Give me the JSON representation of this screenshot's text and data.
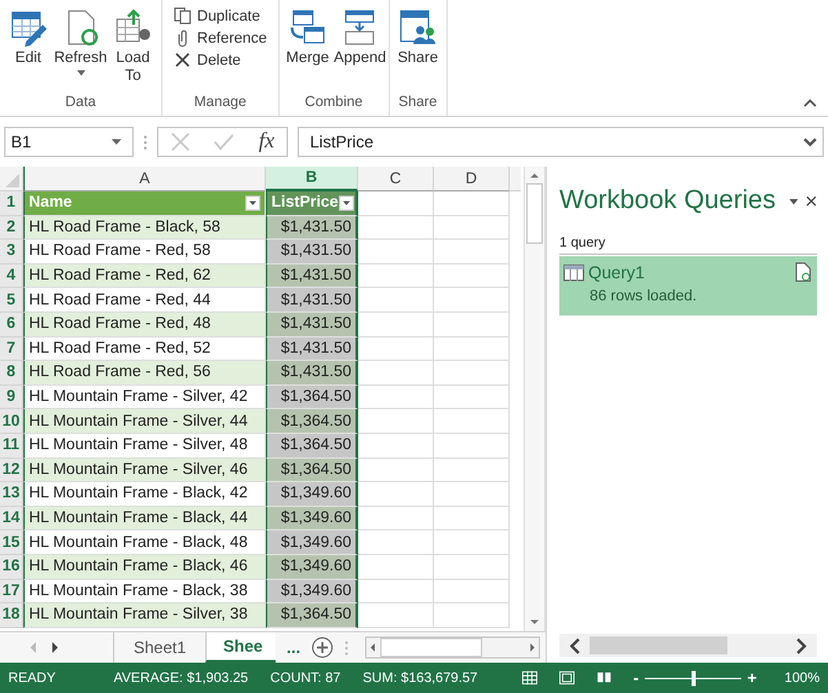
{
  "ribbon": {
    "groups": [
      {
        "label": "Data",
        "buttons": [
          {
            "label": "Edit",
            "kind": "large",
            "has_menu": false
          },
          {
            "label": "Refresh",
            "kind": "large",
            "has_menu": true
          },
          {
            "label": "Load To",
            "kind": "large",
            "has_menu": false
          }
        ]
      },
      {
        "label": "Manage",
        "buttons": [
          {
            "label": "Duplicate",
            "kind": "small",
            "has_menu": false
          },
          {
            "label": "Reference",
            "kind": "small",
            "has_menu": false
          },
          {
            "label": "Delete",
            "kind": "small",
            "has_menu": false
          }
        ]
      },
      {
        "label": "Combine",
        "buttons": [
          {
            "label": "Merge",
            "kind": "large",
            "has_menu": false
          },
          {
            "label": "Append",
            "kind": "large",
            "has_menu": false
          }
        ]
      },
      {
        "label": "Share",
        "buttons": [
          {
            "label": "Share",
            "kind": "large",
            "has_menu": false
          }
        ]
      }
    ]
  },
  "formula_bar": {
    "name_box": "B1",
    "fx": "fx",
    "formula": "ListPrice"
  },
  "columns": [
    {
      "label": "A",
      "selected": false
    },
    {
      "label": "B",
      "selected": true
    },
    {
      "label": "C",
      "selected": false
    },
    {
      "label": "D",
      "selected": false
    }
  ],
  "table": {
    "rows": [
      {
        "number": "1",
        "name": "Name",
        "price": "ListPrice",
        "kind": "header"
      },
      {
        "number": "2",
        "name": "HL Road Frame - Black, 58",
        "price": "$1,431.50",
        "kind": "data"
      },
      {
        "number": "3",
        "name": "HL Road Frame - Red, 58",
        "price": "$1,431.50",
        "kind": "data"
      },
      {
        "number": "4",
        "name": "HL Road Frame - Red, 62",
        "price": "$1,431.50",
        "kind": "data"
      },
      {
        "number": "5",
        "name": "HL Road Frame - Red, 44",
        "price": "$1,431.50",
        "kind": "data"
      },
      {
        "number": "6",
        "name": "HL Road Frame - Red, 48",
        "price": "$1,431.50",
        "kind": "data"
      },
      {
        "number": "7",
        "name": "HL Road Frame - Red, 52",
        "price": "$1,431.50",
        "kind": "data"
      },
      {
        "number": "8",
        "name": "HL Road Frame - Red, 56",
        "price": "$1,431.50",
        "kind": "data"
      },
      {
        "number": "9",
        "name": "HL Mountain Frame - Silver, 42",
        "price": "$1,364.50",
        "kind": "data"
      },
      {
        "number": "10",
        "name": "HL Mountain Frame - Silver, 44",
        "price": "$1,364.50",
        "kind": "data"
      },
      {
        "number": "11",
        "name": "HL Mountain Frame - Silver, 48",
        "price": "$1,364.50",
        "kind": "data"
      },
      {
        "number": "12",
        "name": "HL Mountain Frame - Silver, 46",
        "price": "$1,364.50",
        "kind": "data"
      },
      {
        "number": "13",
        "name": "HL Mountain Frame - Black, 42",
        "price": "$1,349.60",
        "kind": "data"
      },
      {
        "number": "14",
        "name": "HL Mountain Frame - Black, 44",
        "price": "$1,349.60",
        "kind": "data"
      },
      {
        "number": "15",
        "name": "HL Mountain Frame - Black, 48",
        "price": "$1,349.60",
        "kind": "data"
      },
      {
        "number": "16",
        "name": "HL Mountain Frame - Black, 46",
        "price": "$1,349.60",
        "kind": "data"
      },
      {
        "number": "17",
        "name": "HL Mountain Frame - Black, 38",
        "price": "$1,349.60",
        "kind": "data"
      },
      {
        "number": "18",
        "name": "HL Mountain Frame - Silver, 38",
        "price": "$1,364.50",
        "kind": "data"
      }
    ]
  },
  "sheet_tabs": [
    {
      "label": "Sheet1",
      "selected": false
    },
    {
      "label": "Shee",
      "selected": true
    }
  ],
  "more_tabs": "...",
  "queries_pane": {
    "title": "Workbook Queries",
    "count": "1 query",
    "queries": [
      {
        "name": "Query1",
        "status": "86 rows loaded.",
        "selected": true
      }
    ]
  },
  "status_bar": {
    "state": "READY",
    "average": "AVERAGE: $1,903.25",
    "count": "COUNT: 87",
    "sum": "SUM: $163,679.57",
    "zoom": "100%",
    "zoom_out": "-",
    "zoom_in": "+",
    "zoom_slider": {
      "level": 0.5
    }
  }
}
